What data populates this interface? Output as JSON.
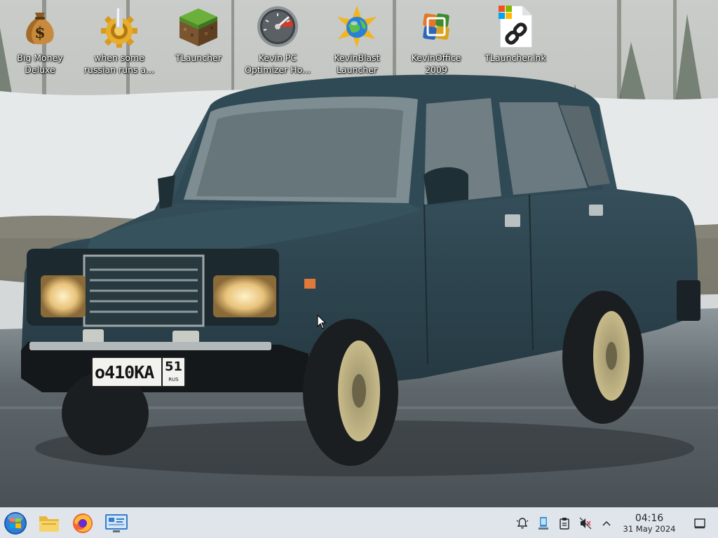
{
  "desktop": {
    "icons": [
      {
        "label_line1": "Big Money",
        "label_line2": "Deluxe",
        "icon": "money-bag-icon"
      },
      {
        "label_line1": "when some",
        "label_line2": "russian runs a...",
        "icon": "gear-icon"
      },
      {
        "label_line1": "TLauncher",
        "label_line2": "",
        "icon": "grass-block-icon"
      },
      {
        "label_line1": "Kevin PC",
        "label_line2": "Optimizer Ho...",
        "icon": "speedometer-icon"
      },
      {
        "label_line1": "KevinBlast",
        "label_line2": "Launcher",
        "icon": "star-globe-icon"
      },
      {
        "label_line1": "KevinOffice",
        "label_line2": "2009",
        "icon": "office-logo-icon"
      },
      {
        "label_line1": "TLauncher.lnk",
        "label_line2": "",
        "icon": "shortcut-file-icon"
      }
    ]
  },
  "wallpaper": {
    "license_plate": {
      "number": "о410КА",
      "region": "51",
      "country": "RUS"
    }
  },
  "taskbar": {
    "apps": [
      {
        "icon": "start-orb-icon"
      },
      {
        "icon": "folder-icon"
      },
      {
        "icon": "firefox-icon"
      },
      {
        "icon": "control-panel-icon"
      }
    ],
    "tray": [
      {
        "icon": "notifications-icon"
      },
      {
        "icon": "network-icon"
      },
      {
        "icon": "clipboard-icon"
      },
      {
        "icon": "volume-muted-icon"
      },
      {
        "icon": "chevron-up-icon"
      }
    ],
    "clock": {
      "time": "04:16",
      "date": "31 May 2024"
    }
  },
  "colors": {
    "taskbar_bg": "#dfe5ea",
    "car_body": "#2c4550",
    "headlight": "#e8c27a"
  }
}
